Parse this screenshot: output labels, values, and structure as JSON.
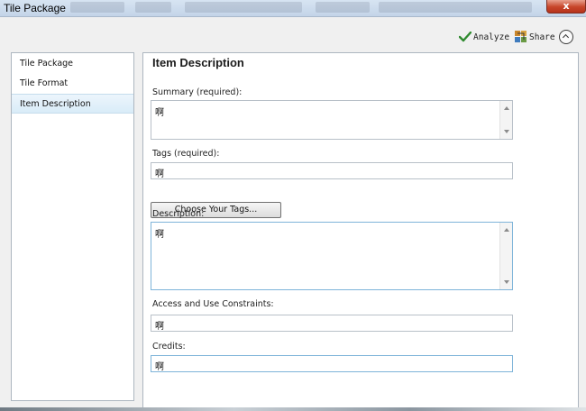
{
  "window": {
    "title": "Tile Package",
    "close_label": "x"
  },
  "toolbar": {
    "analyze_label": "Analyze",
    "share_label": "Share",
    "colors": {
      "check": "#2f8a2f"
    }
  },
  "nav": {
    "items": [
      {
        "label": "Tile Package"
      },
      {
        "label": "Tile Format"
      },
      {
        "label": "Item Description",
        "selected": true
      }
    ]
  },
  "form": {
    "heading": "Item Description",
    "summary": {
      "label": "Summary (required):",
      "value": "啊"
    },
    "tags": {
      "label": "Tags (required):",
      "value": "啊"
    },
    "choose_tags_label": "Choose Your Tags...",
    "description": {
      "label": "Description:",
      "value": "啊"
    },
    "access": {
      "label": "Access and Use Constraints:",
      "value": "啊"
    },
    "credits": {
      "label": "Credits:",
      "value": "啊"
    }
  }
}
